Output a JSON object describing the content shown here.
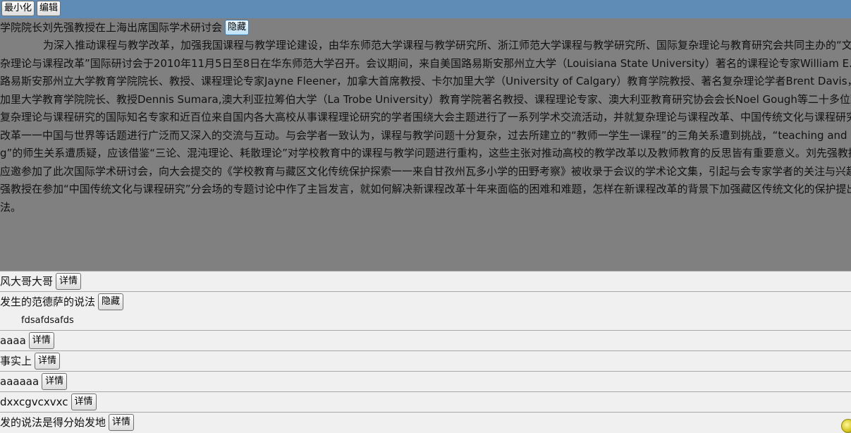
{
  "toolbar": {
    "minimize_label": "最小化",
    "edit_label": "编辑"
  },
  "news": {
    "title": "学院院长刘先强教授在上海出席国际学术研讨会",
    "hide_label": "隐藏",
    "article": "为深入推动课程与教学改革，加强我国课程与教学理论建设，由华东师范大学课程与教学研究所、浙江师范大学课程与教学研究所、国际复杂理论与教育研究会共同主办的“文化、复杂理论与课程改革”国际研讨会于2010年11月5日至8日在华东师范大学召开。会议期间，来自美国路易斯安那州立大学（Louisiana State University）著名的课程论专家William E. Doll，路易斯安那州立大学教育学院院长、教授、课程理论专家Jayne Fleener，加拿大首席教授、卡尔加里大学（University of Calgary）教育学院教授、著名复杂理论学者Brent Davis，卡尔加里大学教育学院院长、教授Dennis Sumara,澳大利亚拉筹伯大学（La Trobe University）教育学院著名教授、课程理论专家、澳大利亚教育研究协会会长Noel Gough等二十多位致力于复杂理论与课程研究的国际知名专家和近百位来自国内各大高校从事课程理论研究的学者围绕大会主题进行了一系列学术交流活动，并就复杂理论与课程改革、中国传统文化与课程研究、课程改革一一中国与世界等话题进行广泛而又深入的交流与互动。与会学者一致认为，课程与教学问题十分复杂，过去所建立的“教师一学生一课程”的三角关系遭到挑战，“teaching and learning”的师生关系遭质疑，应该借鉴“三论、混沌理论、耗散理论”对学校教育中的课程与教学问题进行重构，这些主张对推动高校的教学改革以及教师教育的反思皆有重要意义。刘先强教授一行应邀参加了此次国际学术研讨会，向大会提交的《学校教育与藏区文化传统保护探索一一来自甘孜州瓦多小学的田野考察》被收录于会议的学术论文集，引起与会专家学者的关注与兴趣。刘先强教授在参加“中国传统文化与课程研究”分会场的专题讨论中作了主旨发言，就如何解决新课程改革十年来面临的困难和难题，怎样在新课程改革的背景下加强藏区传统文化的保护提出了看法。"
  },
  "list": [
    {
      "title": "风大哥大哥",
      "button": "详情"
    },
    {
      "title": "发生的范德萨的说法",
      "button": "隐藏",
      "detail": "fdsafdsafds"
    },
    {
      "title": "aaaa",
      "button": "详情"
    },
    {
      "title": "事实上",
      "button": "详情"
    },
    {
      "title": "aaaaaa",
      "button": "详情"
    },
    {
      "title": "dxxcgvcxvxc",
      "button": "详情"
    },
    {
      "title": "发的说法是得分始发地",
      "button": "详情"
    }
  ],
  "colors": {
    "topbar": "#5f8bb7",
    "content_bg": "#808080",
    "page_bg": "#f0f0f0"
  }
}
